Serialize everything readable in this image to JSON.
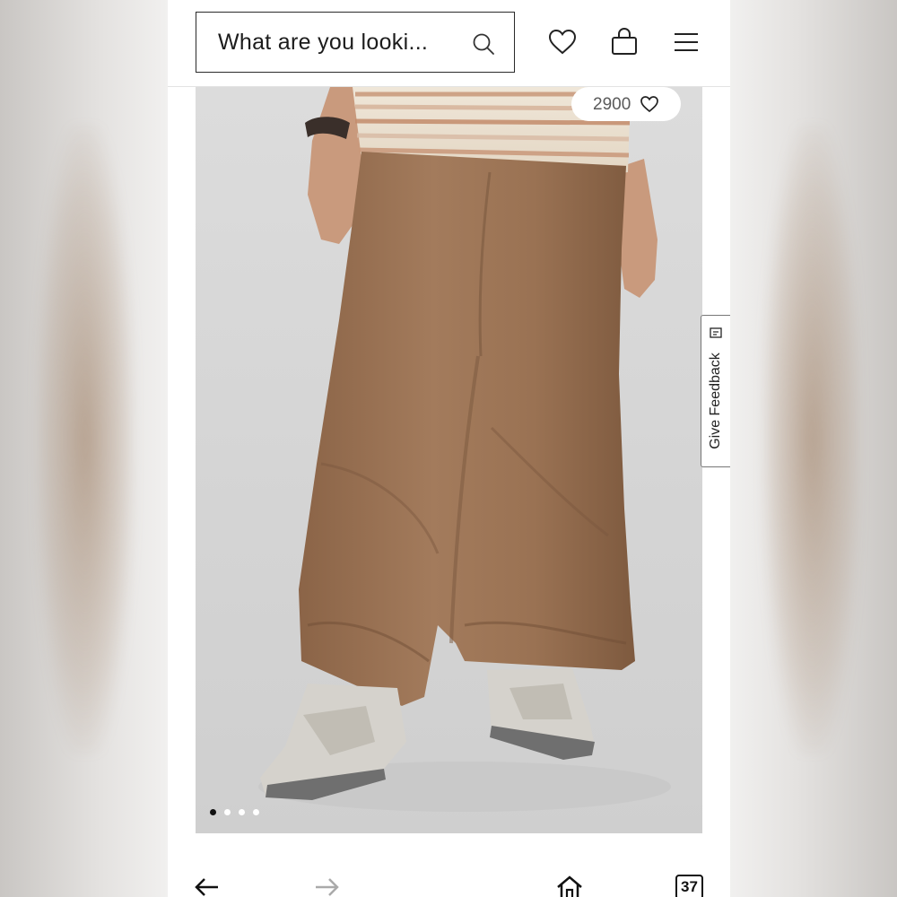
{
  "header": {
    "search": {
      "placeholder": "What are you looki..."
    },
    "icons": [
      "search-icon",
      "heart-icon",
      "bag-icon",
      "menu-icon"
    ]
  },
  "product": {
    "likes": "2900",
    "image_count": 4,
    "active_image": 1,
    "expand_icon": "expand-icon"
  },
  "feedback": {
    "label": "Give Feedback"
  },
  "browser_nav": {
    "tabs_count": "37"
  },
  "colors": {
    "pants": "#9a7456",
    "background": "#d6d6d6",
    "text": "#1c1c1c"
  }
}
